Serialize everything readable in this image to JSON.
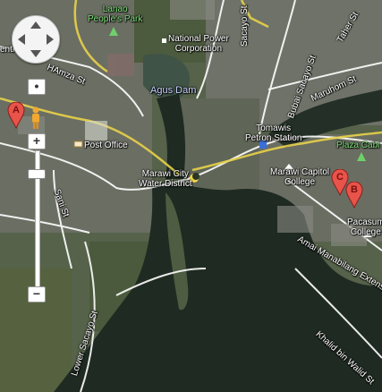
{
  "map": {
    "labels": {
      "lanao_peoples_park": "Lanao\nPeople's Park",
      "national_power_corp": "National Power\nCorporation",
      "agus_dam": "Agus Dam",
      "post_office": "Post Office",
      "marawi_water_district": "Marawi City\nWater District",
      "tomawis_petron": "Tomawis\nPetron Station",
      "marawi_capitol_college": "Marawi Capitol\nCollege",
      "pacasum_college": "Pacasum\nCollege",
      "plaza_cabili": "Plaza Cabi",
      "hamza_st": "HAmza St",
      "sani_st": "Sani St",
      "lower_sacayo_st": "Lower Sacayo St",
      "bubai_sacayo_st": "Bubai Sacayo St",
      "maruhom_st": "Maruhom St",
      "taher_st": "Taher St",
      "amai_manabilang_ext": "Amai Manabilang Extensi",
      "khalid_bin_walid_st": "Khalid bin Walid St",
      "sacayo_partial": "Sacayo St",
      "centr_partial": "entr"
    },
    "markers": [
      {
        "letter": "A",
        "name": "marker-a"
      },
      {
        "letter": "B",
        "name": "marker-b"
      },
      {
        "letter": "C",
        "name": "marker-c"
      }
    ],
    "controls": {
      "zoom_in": "+",
      "zoom_out": "−",
      "zoom_level_fraction": 0.14
    },
    "colors": {
      "water": "#1f2a22",
      "marker": "#e8534a",
      "park_label": "#7fe07a"
    }
  }
}
